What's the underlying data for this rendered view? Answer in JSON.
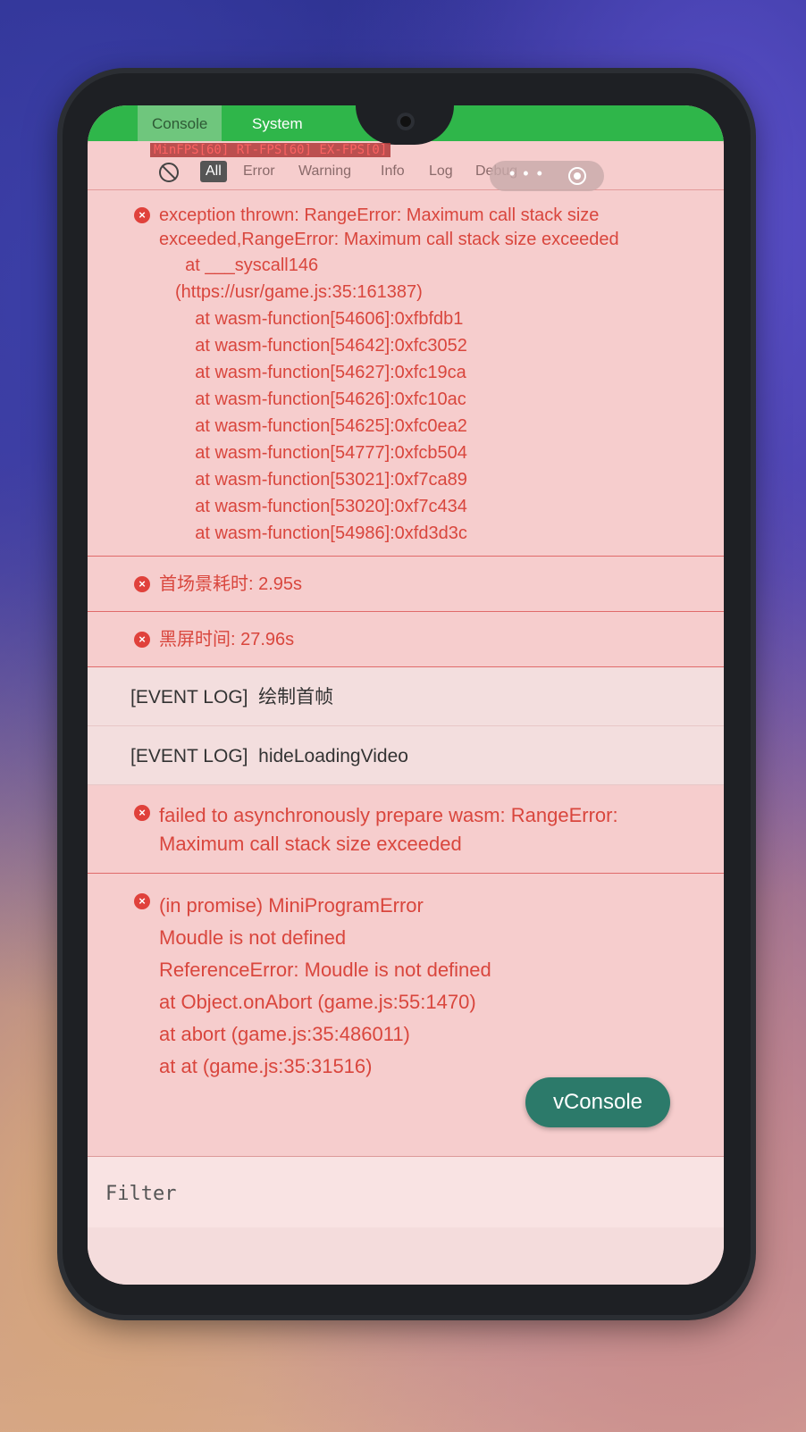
{
  "tabs": {
    "console": "Console",
    "system": "System"
  },
  "fps_text": "MinFPS[60] RT-FPS[60] EX-FPS[0]",
  "filters": [
    "All",
    "Error",
    "Warning",
    "Info",
    "Log",
    "Debug"
  ],
  "capsule": {
    "more_icon": "more-dots-icon",
    "close_icon": "target-icon"
  },
  "entries": [
    {
      "type": "error",
      "message": "exception thrown: RangeError: Maximum call stack size exceeded,RangeError: Maximum call stack size exceeded",
      "stack": [
        "  at ___syscall146",
        "(https://usr/game.js:35:161387)",
        "    at wasm-function[54606]:0xfbfdb1",
        "    at wasm-function[54642]:0xfc3052",
        "    at wasm-function[54627]:0xfc19ca",
        "    at wasm-function[54626]:0xfc10ac",
        "    at wasm-function[54625]:0xfc0ea2",
        "    at wasm-function[54777]:0xfcb504",
        "    at wasm-function[53021]:0xf7ca89",
        "    at wasm-function[53020]:0xf7c434",
        "    at wasm-function[54986]:0xfd3d3c"
      ]
    },
    {
      "type": "error",
      "message": "首场景耗时: 2.95s"
    },
    {
      "type": "error",
      "message": "黑屏时间: 27.96s"
    },
    {
      "type": "log",
      "message": "[EVENT LOG]  绘制首帧"
    },
    {
      "type": "log",
      "message": "[EVENT LOG]  hideLoadingVideo"
    },
    {
      "type": "error",
      "message": "failed to asynchronously prepare wasm: RangeError: Maximum call stack size exceeded"
    },
    {
      "type": "error",
      "message": "(in promise) MiniProgramError\nMoudle is not defined\nReferenceError: Moudle is not defined\nat Object.onAbort (game.js:55:1470)\nat abort (game.js:35:486011)\nat at (game.js:35:31516)"
    }
  ],
  "vconsole_label": "vConsole",
  "filter_placeholder": "Filter",
  "error_icon_glyph": "×"
}
